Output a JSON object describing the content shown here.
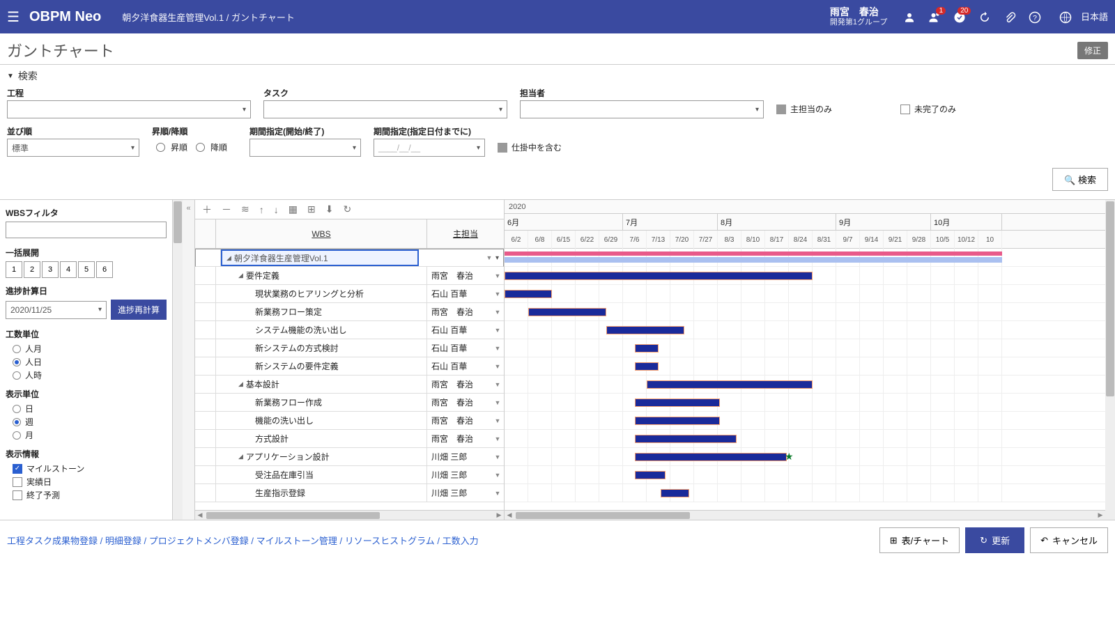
{
  "header": {
    "logo": "OBPM Neo",
    "breadcrumb": "朝夕洋食器生産管理Vol.1 / ガントチャート",
    "user_name": "雨宮　春治",
    "user_group": "開発第1グループ",
    "badge1": "1",
    "badge2": "20",
    "lang": "日本語"
  },
  "title": "ガントチャート",
  "edit_btn": "修正",
  "search": {
    "title": "検索",
    "process": "工程",
    "task": "タスク",
    "assignee": "担当者",
    "main_only": "主担当のみ",
    "incomplete_only": "未完了のみ",
    "sort": "並び順",
    "sort_value": "標準",
    "asc_desc": "昇順/降順",
    "asc": "昇順",
    "desc": "降順",
    "period_se": "期間指定(開始/終了)",
    "period_by": "期間指定(指定日付までに)",
    "period_by_ph": "____/__/__",
    "include_wip": "仕掛中を含む",
    "search_btn": "検索"
  },
  "sidebar": {
    "filter": "WBSフィルタ",
    "expand_all": "一括展開",
    "levels": [
      "1",
      "2",
      "3",
      "4",
      "5",
      "6"
    ],
    "calc_date_lbl": "進捗計算日",
    "calc_date": "2020/11/25",
    "recalc": "進捗再計算",
    "effort_unit": "工数単位",
    "effort_opts": [
      "人月",
      "人日",
      "人時"
    ],
    "disp_unit": "表示単位",
    "disp_opts": [
      "日",
      "週",
      "月"
    ],
    "disp_info": "表示情報",
    "info_opts": [
      "マイルストーン",
      "実績日",
      "終了予測"
    ]
  },
  "wbs": {
    "col_wbs": "WBS",
    "col_owner": "主担当",
    "rows": [
      {
        "level": 0,
        "name": "朝夕洋食器生産管理Vol.1",
        "owner": "",
        "exp": true,
        "sel": true
      },
      {
        "level": 1,
        "name": "要件定義",
        "owner": "雨宮　春治",
        "exp": true
      },
      {
        "level": 2,
        "name": "現状業務のヒアリングと分析",
        "owner": "石山 百華"
      },
      {
        "level": 2,
        "name": "新業務フロー策定",
        "owner": "雨宮　春治"
      },
      {
        "level": 2,
        "name": "システム機能の洗い出し",
        "owner": "石山 百華"
      },
      {
        "level": 2,
        "name": "新システムの方式検討",
        "owner": "石山 百華"
      },
      {
        "level": 2,
        "name": "新システムの要件定義",
        "owner": "石山 百華"
      },
      {
        "level": 1,
        "name": "基本設計",
        "owner": "雨宮　春治",
        "exp": true
      },
      {
        "level": 2,
        "name": "新業務フロー作成",
        "owner": "雨宮　春治"
      },
      {
        "level": 2,
        "name": "機能の洗い出し",
        "owner": "雨宮　春治"
      },
      {
        "level": 2,
        "name": "方式設計",
        "owner": "雨宮　春治"
      },
      {
        "level": 1,
        "name": "アプリケーション設計",
        "owner": "川畑 三郎",
        "exp": true
      },
      {
        "level": 2,
        "name": "受注品在庫引当",
        "owner": "川畑 三郎"
      },
      {
        "level": 2,
        "name": "生産指示登録",
        "owner": "川畑 三郎"
      }
    ]
  },
  "timeline": {
    "year": "2020",
    "months": [
      {
        "label": "6月",
        "weeks": 5
      },
      {
        "label": "7月",
        "weeks": 4
      },
      {
        "label": "8月",
        "weeks": 5
      },
      {
        "label": "9月",
        "weeks": 4
      },
      {
        "label": "10月",
        "weeks": 3
      }
    ],
    "weeks": [
      "6/2",
      "6/8",
      "6/15",
      "6/22",
      "6/29",
      "7/6",
      "7/13",
      "7/20",
      "7/27",
      "8/3",
      "8/10",
      "8/17",
      "8/24",
      "8/31",
      "9/7",
      "9/14",
      "9/21",
      "9/28",
      "10/5",
      "10/12",
      "10"
    ]
  },
  "bars": [
    {
      "row": 0,
      "type": "pink",
      "start": 0,
      "span": 21
    },
    {
      "row": 0,
      "type": "lblue",
      "start": 0,
      "span": 21
    },
    {
      "row": 1,
      "start": 0,
      "span": 13
    },
    {
      "row": 2,
      "start": 0,
      "span": 2
    },
    {
      "row": 3,
      "start": 1,
      "span": 3.3
    },
    {
      "row": 4,
      "start": 4.3,
      "span": 3.3
    },
    {
      "row": 5,
      "start": 5.5,
      "span": 1
    },
    {
      "row": 6,
      "start": 5.5,
      "span": 1
    },
    {
      "row": 7,
      "start": 6,
      "span": 7
    },
    {
      "row": 8,
      "start": 5.5,
      "span": 3.6
    },
    {
      "row": 9,
      "start": 5.5,
      "span": 3.6
    },
    {
      "row": 10,
      "start": 5.5,
      "span": 4.3
    },
    {
      "row": 11,
      "start": 5.5,
      "span": 6.4,
      "star": 12
    },
    {
      "row": 12,
      "start": 5.5,
      "span": 1.3
    },
    {
      "row": 13,
      "start": 6.6,
      "span": 1.2
    }
  ],
  "footer": {
    "links": [
      "工程タスク成果物登録",
      "明細登録",
      "プロジェクトメンバ登録",
      "マイルストーン管理",
      "リソースヒストグラム",
      "工数入力"
    ],
    "table_chart": "表/チャート",
    "update": "更新",
    "cancel": "キャンセル"
  }
}
